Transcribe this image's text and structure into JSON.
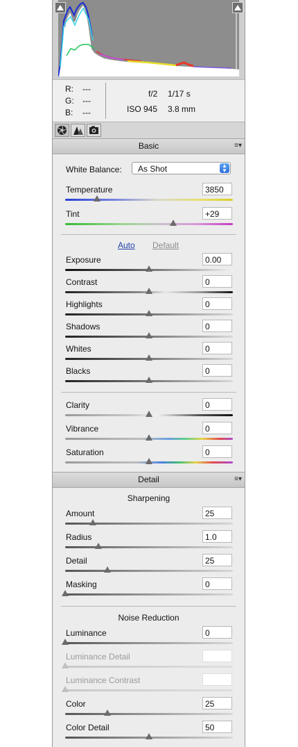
{
  "histogram": {
    "shadow_clip_icon": "triangle-up-icon",
    "highlight_clip_icon": "triangle-up-icon"
  },
  "readout": {
    "r_label": "R:",
    "r_value": "---",
    "g_label": "G:",
    "g_value": "---",
    "b_label": "B:",
    "b_value": "---",
    "aperture": "f/2",
    "shutter": "1/17 s",
    "iso": "ISO 945",
    "focal": "3.8 mm"
  },
  "tabs": [
    {
      "icon": "aperture-icon",
      "active": true
    },
    {
      "icon": "tone-curve-icon",
      "active": false
    },
    {
      "icon": "camera-icon",
      "active": false
    }
  ],
  "basic": {
    "title": "Basic",
    "white_balance_label": "White Balance:",
    "white_balance_value": "As Shot",
    "temperature": {
      "label": "Temperature",
      "value": "3850",
      "level": 0.19
    },
    "tint": {
      "label": "Tint",
      "value": "+29",
      "level": 0.645
    },
    "auto_label": "Auto",
    "default_label": "Default",
    "tone": [
      {
        "label": "Exposure",
        "value": "0.00",
        "level": 0.5
      },
      {
        "label": "Contrast",
        "value": "0",
        "level": 0.5
      },
      {
        "label": "Highlights",
        "value": "0",
        "level": 0.5
      },
      {
        "label": "Shadows",
        "value": "0",
        "level": 0.5
      },
      {
        "label": "Whites",
        "value": "0",
        "level": 0.5
      },
      {
        "label": "Blacks",
        "value": "0",
        "level": 0.5
      }
    ],
    "presence": [
      {
        "label": "Clarity",
        "value": "0",
        "level": 0.5
      },
      {
        "label": "Vibrance",
        "value": "0",
        "level": 0.5
      },
      {
        "label": "Saturation",
        "value": "0",
        "level": 0.5
      }
    ]
  },
  "detail": {
    "title": "Detail",
    "sharpening_title": "Sharpening",
    "sharpening": [
      {
        "label": "Amount",
        "value": "25",
        "level": 0.167,
        "disabled": false
      },
      {
        "label": "Radius",
        "value": "1.0",
        "level": 0.2,
        "disabled": false
      },
      {
        "label": "Detail",
        "value": "25",
        "level": 0.25,
        "disabled": false
      },
      {
        "label": "Masking",
        "value": "0",
        "level": 0.0,
        "disabled": false
      }
    ],
    "noise_title": "Noise Reduction",
    "noise": [
      {
        "label": "Luminance",
        "value": "0",
        "level": 0.0,
        "disabled": false
      },
      {
        "label": "Luminance Detail",
        "value": "",
        "level": 0.0,
        "disabled": true
      },
      {
        "label": "Luminance Contrast",
        "value": "",
        "level": 0.0,
        "disabled": true
      },
      {
        "label": "Color",
        "value": "25",
        "level": 0.25,
        "disabled": false
      },
      {
        "label": "Color Detail",
        "value": "50",
        "level": 0.5,
        "disabled": false
      }
    ]
  },
  "panel_menu_icon": "panel-menu-icon",
  "colors": {
    "accent_link": "#1f3fa8",
    "thumb": "#6b6b6b",
    "panel_bg": "#ececec"
  }
}
